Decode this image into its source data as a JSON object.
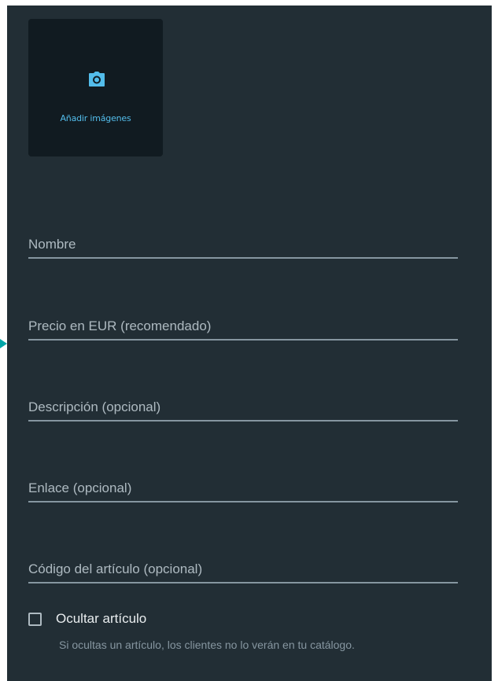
{
  "image_upload": {
    "label": "Añadir imágenes",
    "icon": "camera-icon",
    "accent_color": "#53bdeb"
  },
  "fields": [
    {
      "placeholder": "Nombre",
      "value": ""
    },
    {
      "placeholder": "Precio en EUR (recomendado)",
      "value": ""
    },
    {
      "placeholder": "Descripción (opcional)",
      "value": ""
    },
    {
      "placeholder": "Enlace (opcional)",
      "value": ""
    },
    {
      "placeholder": "Código del artículo (opcional)",
      "value": ""
    }
  ],
  "hide_item": {
    "label": "Ocultar artículo",
    "checked": false,
    "hint": "Si ocultas un artículo, los clientes no lo verán en tu catálogo."
  },
  "colors": {
    "panel_bg": "#222e35",
    "image_box_bg": "#111b21",
    "marker": "#00a5a8"
  }
}
